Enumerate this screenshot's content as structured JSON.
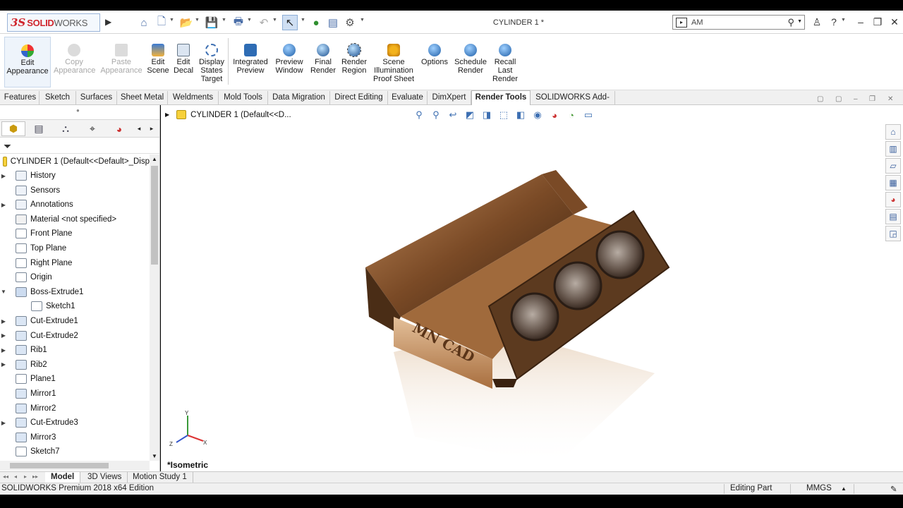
{
  "app": {
    "brand_ds": "3S",
    "brand_solid": "SOLID",
    "brand_works": "WORKS",
    "document_title": "CYLINDER 1 *"
  },
  "search": {
    "value": "AM",
    "placeholder": ""
  },
  "ribbon": {
    "buttons": [
      {
        "label": "Edit Appearance",
        "icon": "appearance-icon",
        "enabled": true
      },
      {
        "label": "Copy Appearance",
        "icon": "copy-appearance-icon",
        "enabled": false
      },
      {
        "label": "Paste Appearance",
        "icon": "paste-appearance-icon",
        "enabled": false
      },
      {
        "label": "Edit Scene",
        "icon": "scene-icon",
        "enabled": true
      },
      {
        "label": "Edit Decal",
        "icon": "decal-icon",
        "enabled": true
      },
      {
        "label": "Display States Target",
        "icon": "display-states-icon",
        "enabled": true
      },
      {
        "label": "Integrated Preview",
        "icon": "integrated-preview-icon",
        "enabled": true
      },
      {
        "label": "Preview Window",
        "icon": "preview-window-icon",
        "enabled": true
      },
      {
        "label": "Final Render",
        "icon": "final-render-icon",
        "enabled": true
      },
      {
        "label": "Render Region",
        "icon": "render-region-icon",
        "enabled": true
      },
      {
        "label": "Scene Illumination Proof Sheet",
        "icon": "illumination-icon",
        "enabled": true
      },
      {
        "label": "Options",
        "icon": "options-icon",
        "enabled": true
      },
      {
        "label": "Schedule Render",
        "icon": "schedule-render-icon",
        "enabled": true
      },
      {
        "label": "Recall Last Render",
        "icon": "recall-render-icon",
        "enabled": true
      }
    ]
  },
  "command_tabs": [
    "Features",
    "Sketch",
    "Surfaces",
    "Sheet Metal",
    "Weldments",
    "Mold Tools",
    "Data Migration",
    "Direct Editing",
    "Evaluate",
    "DimXpert",
    "Render Tools",
    "SOLIDWORKS Add-Ins"
  ],
  "active_command_tab": "Render Tools",
  "tree": {
    "root": "CYLINDER 1  (Default<<Default>_Disp",
    "items": [
      {
        "label": "History",
        "icon": "history-icon",
        "expandable": true
      },
      {
        "label": "Sensors",
        "icon": "sensors-icon",
        "expandable": false
      },
      {
        "label": "Annotations",
        "icon": "annotations-icon",
        "expandable": true
      },
      {
        "label": "Material <not specified>",
        "icon": "material-icon",
        "expandable": false
      },
      {
        "label": "Front Plane",
        "icon": "plane-icon",
        "expandable": false
      },
      {
        "label": "Top Plane",
        "icon": "plane-icon",
        "expandable": false
      },
      {
        "label": "Right Plane",
        "icon": "plane-icon",
        "expandable": false
      },
      {
        "label": "Origin",
        "icon": "origin-icon",
        "expandable": false
      },
      {
        "label": "Boss-Extrude1",
        "icon": "boss-extrude-icon",
        "expandable": true
      },
      {
        "label": "Sketch1",
        "icon": "sketch-icon",
        "expandable": false
      },
      {
        "label": "Cut-Extrude1",
        "icon": "cut-extrude-icon",
        "expandable": true
      },
      {
        "label": "Cut-Extrude2",
        "icon": "cut-extrude-icon",
        "expandable": true
      },
      {
        "label": "Rib1",
        "icon": "rib-icon",
        "expandable": true
      },
      {
        "label": "Rib2",
        "icon": "rib-icon",
        "expandable": true
      },
      {
        "label": "Plane1",
        "icon": "plane-icon",
        "expandable": false
      },
      {
        "label": "Mirror1",
        "icon": "mirror-icon",
        "expandable": false
      },
      {
        "label": "Mirror2",
        "icon": "mirror-icon",
        "expandable": false
      },
      {
        "label": "Cut-Extrude3",
        "icon": "cut-extrude-icon",
        "expandable": true
      },
      {
        "label": "Mirror3",
        "icon": "mirror-icon",
        "expandable": false
      },
      {
        "label": "Sketch7",
        "icon": "sketch-icon",
        "expandable": false
      }
    ]
  },
  "viewport": {
    "breadcrumb": "CYLINDER 1  (Default<<D...",
    "view_label": "*Isometric",
    "model_engraving": "MN CAD",
    "triad": {
      "x": "X",
      "y": "Y",
      "z": "Z"
    }
  },
  "bottom_tabs": [
    "Model",
    "3D Views",
    "Motion Study 1"
  ],
  "active_bottom_tab": "Model",
  "status": {
    "edition": "SOLIDWORKS Premium 2018 x64 Edition",
    "mode": "Editing Part",
    "units": "MMGS"
  },
  "colors": {
    "accent": "#3d6fb2",
    "brand_red": "#d0262d",
    "model_bronze": "#8a5a32"
  }
}
